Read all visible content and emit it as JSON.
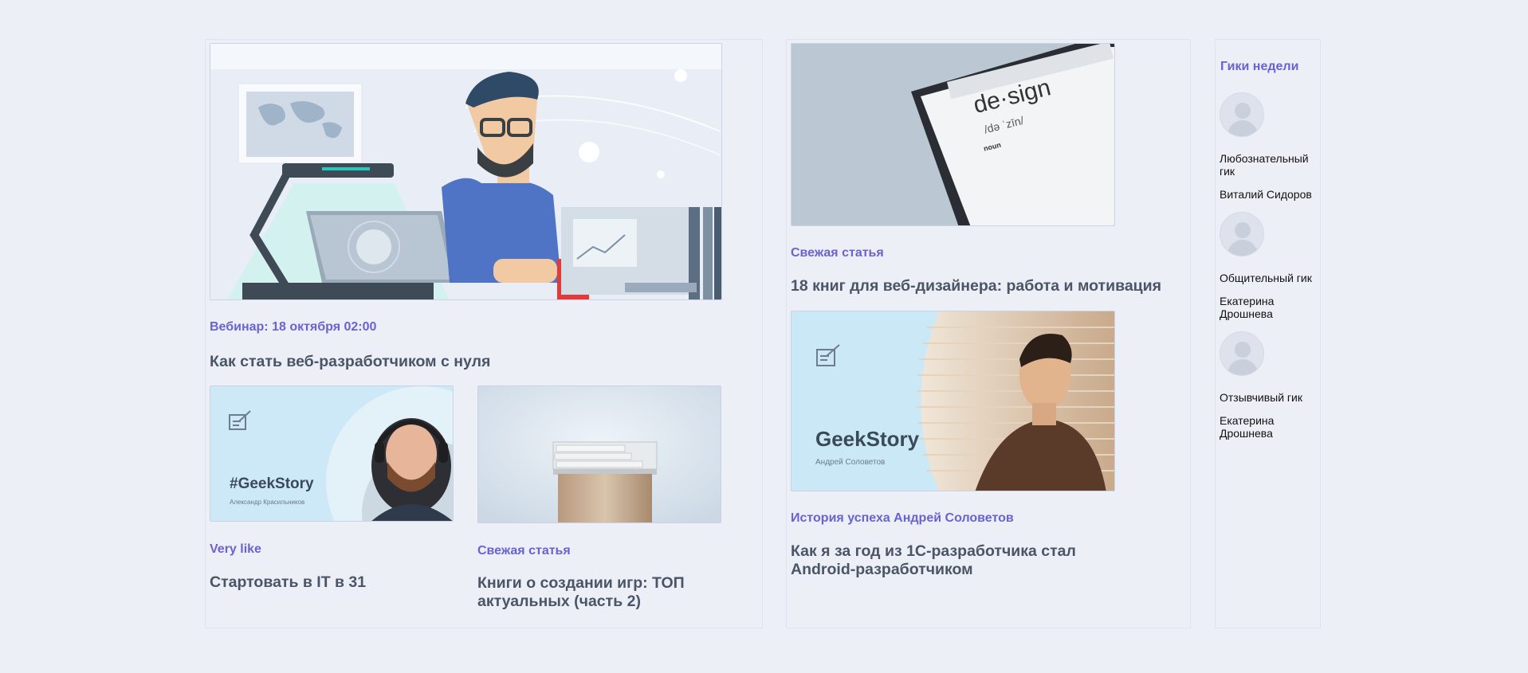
{
  "left": {
    "hero": {
      "tag": "Вебинар: 18 октября 02:00",
      "title": "Как стать веб-разработчиком с нуля"
    },
    "card_a": {
      "brand": "#GeekStory",
      "author": "Александр Красильников",
      "tag": "Very like",
      "title": "Стартовать в IT в 31"
    },
    "card_b": {
      "tag": "Свежая статья",
      "title": "Книги о создании игр: ТОП актуальных (часть 2)"
    }
  },
  "middle": {
    "card_design": {
      "word": "de·sign",
      "phon": "/də ˈzīn/",
      "pos": "noun",
      "tag": "Свежая статья",
      "title": "18 книг для веб-дизайнера: работа и мотивация"
    },
    "card_story": {
      "brand": "GeekStory",
      "author": "Андрей Соловетов",
      "tag": "История успеха Андрей Соловетов",
      "title": "Как я за год из 1С-разработчика стал Android-разработчиком"
    }
  },
  "sidebar": {
    "title": "Гики недели",
    "geeks": [
      {
        "kind": "Любознательный гик",
        "name": "Виталий Сидоров"
      },
      {
        "kind": "Общительный гик",
        "name": "Екатерина Дрошнева"
      },
      {
        "kind": "Отзывчивый гик",
        "name": "Екатерина Дрошнева"
      }
    ]
  },
  "colors": {
    "background": "#edeff7",
    "accent": "#6a63cf",
    "title_text": "#4a5567"
  }
}
